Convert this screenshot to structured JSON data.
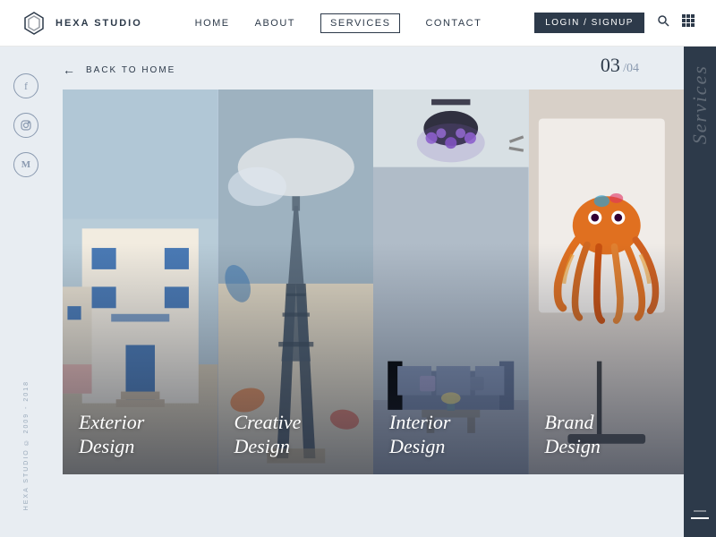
{
  "header": {
    "logo_text": "HEXA STUDIO",
    "nav_items": [
      {
        "label": "HOME",
        "active": false
      },
      {
        "label": "ABOUT",
        "active": false
      },
      {
        "label": "SERVICES",
        "active": true
      },
      {
        "label": "CONTACT",
        "active": false
      }
    ],
    "login_label": "LOGIN / SIGNUP",
    "search_icon": "search",
    "grid_icon": "grid"
  },
  "main": {
    "back_label": "BACK TO HOME",
    "page_current": "03",
    "page_total": "04",
    "sidebar_label": "Services",
    "copyright": "HEXA STUDIO © 2009 - 2018",
    "cards": [
      {
        "id": "exterior",
        "label_line1": "Exterior",
        "label_line2": "Design"
      },
      {
        "id": "creative",
        "label_line1": "Creative",
        "label_line2": "Design"
      },
      {
        "id": "interior",
        "label_line1": "Interior",
        "label_line2": "Design"
      },
      {
        "id": "brand",
        "label_line1": "Brand",
        "label_line2": "Design"
      }
    ],
    "social_icons": [
      {
        "name": "facebook",
        "symbol": "f"
      },
      {
        "name": "instagram",
        "symbol": "◎"
      },
      {
        "name": "medium",
        "symbol": "M"
      }
    ]
  }
}
